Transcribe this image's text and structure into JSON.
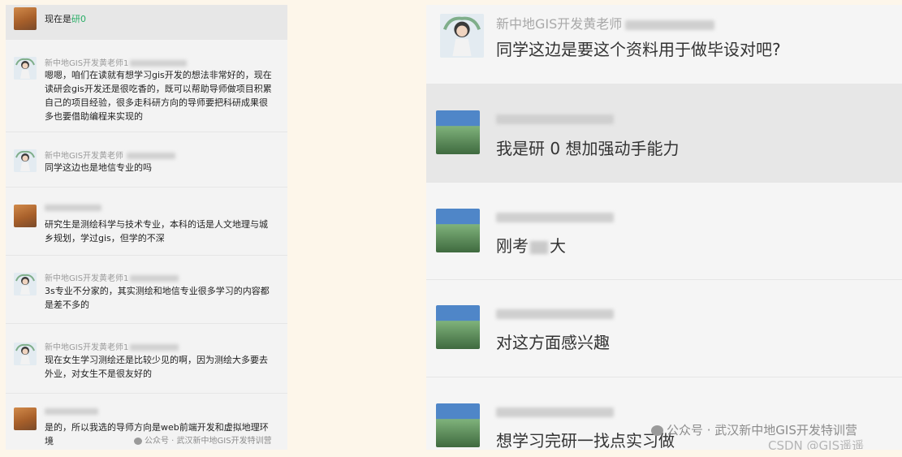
{
  "left_chat": {
    "messages": [
      {
        "id": "m0",
        "name": "",
        "text_prefix": "现在是",
        "text_highlight": "研0",
        "text": ""
      },
      {
        "id": "m1",
        "name": "新中地GIS开发黄老师1",
        "text": "嗯嗯，咱们在读就有想学习gis开发的想法非常好的，现在读研会gis开发还是很吃香的，既可以帮助导师做项目积累自己的项目经验，很多走科研方向的导师要把科研成果很多也要借助编程来实现的"
      },
      {
        "id": "m2",
        "name": "新中地GIS开发黄老师",
        "text": "同学这边也是地信专业的吗"
      },
      {
        "id": "m3",
        "name": "",
        "text": "研究生是测绘科学与技术专业，本科的话是人文地理与城乡规划，学过gis，但学的不深"
      },
      {
        "id": "m4",
        "name": "新中地GIS开发黄老师1",
        "text": "3s专业不分家的，其实测绘和地信专业很多学习的内容都是差不多的"
      },
      {
        "id": "m5",
        "name": "新中地GIS开发黄老师1",
        "text": "现在女生学习测绘还是比较少见的啊，因为测绘大多要去外业，对女生不是很友好的"
      },
      {
        "id": "m6",
        "name": "",
        "text": "是的，所以我选的导师方向是web前端开发和虚拟地理环境"
      }
    ],
    "watermark": "公众号 · 武汉新中地GIS开发特训营"
  },
  "right_chat": {
    "messages": [
      {
        "id": "r0",
        "name": "新中地GIS开发黄老师",
        "text": "同学这边是要这个资料用于做毕设对吧?"
      },
      {
        "id": "r1",
        "name": "",
        "text": "我是研 0 想加强动手能力"
      },
      {
        "id": "r2",
        "name": "",
        "text_a": "刚考",
        "text_b": "大"
      },
      {
        "id": "r3",
        "name": "",
        "text": "对这方面感兴趣"
      },
      {
        "id": "r4",
        "name": "",
        "text": "想学习完研一找点实习做"
      }
    ],
    "watermark": "公众号 · 武汉新中地GIS开发特训营",
    "csdn_watermark": "CSDN @GIS遥遥"
  }
}
